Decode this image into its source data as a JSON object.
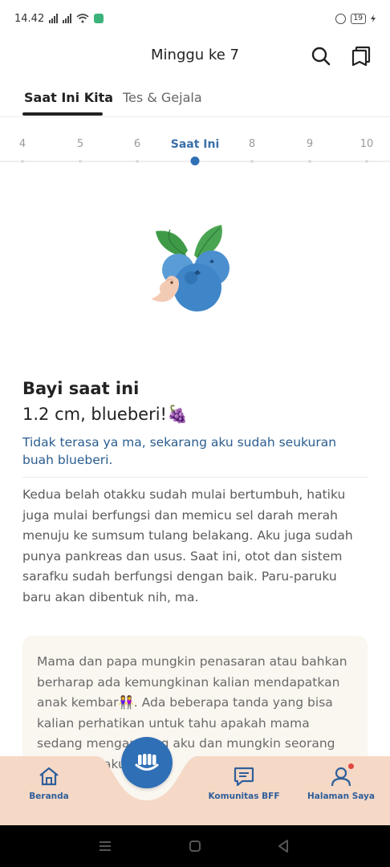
{
  "status_bar": {
    "time": "14.42",
    "battery": "19"
  },
  "header": {
    "title": "Minggu ke 7"
  },
  "tabs": [
    {
      "label": "Saat Ini Kita",
      "active": true
    },
    {
      "label": "Tes & Gejala",
      "active": false
    }
  ],
  "weeks": {
    "labels": [
      "4",
      "5",
      "6",
      "Saat Ini",
      "8",
      "9",
      "10"
    ],
    "current_index": 3
  },
  "content": {
    "heading": "Bayi saat ini",
    "size_line": "1.2 cm, blueberi!🍇",
    "tagline": "Tidak terasa ya ma, sekarang aku sudah seukuran buah blueberi.",
    "body": "Kedua belah otakku sudah mulai bertumbuh, hatiku juga mulai berfungsi dan memicu sel darah merah menuju ke sumsum tulang belakang. Aku juga sudah punya pankreas dan usus. Saat ini, otot dan sistem sarafku sudah berfungsi dengan baik. Paru-paruku baru akan dibentuk nih, ma.",
    "note": "Mama dan papa mungkin penasaran atau bahkan berharap ada kemungkinan kalian mendapatkan anak kembar👭. Ada beberapa tanda yang bisa kalian perhatikan untuk tahu apakah mama sedang mengandung aku dan mungkin seorang kembaran aku."
  },
  "bottom_nav": {
    "home": "Beranda",
    "community": "Komunitas BFF",
    "profile": "Halaman Saya"
  },
  "colors": {
    "accent": "#2f6fb6",
    "tagline": "#2a5d8f",
    "nav_bg": "#f5d8c6",
    "notification": "#e0463f"
  }
}
